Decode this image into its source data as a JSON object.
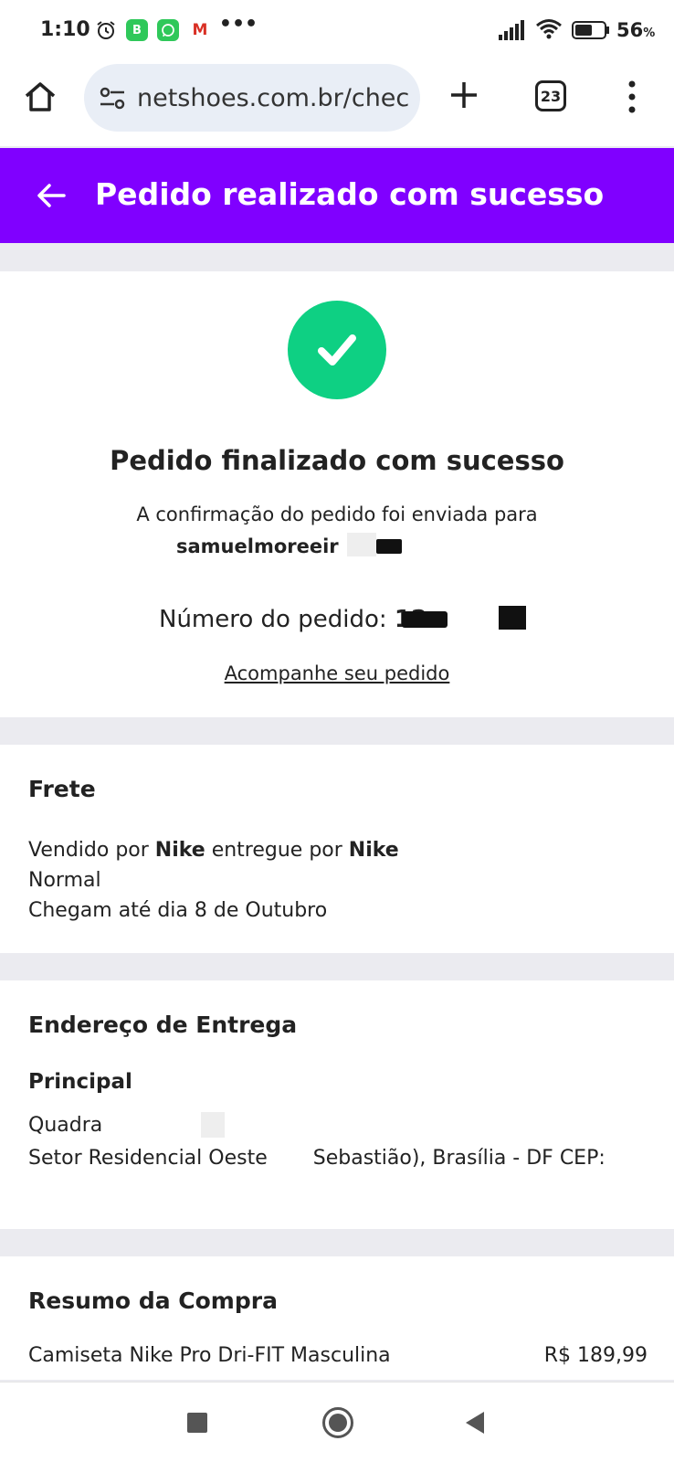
{
  "status_bar": {
    "time": "1:10",
    "battery_percent": "56",
    "battery_unit": "%",
    "icons": [
      "alarm-icon",
      "b-app-icon",
      "whatsapp-icon",
      "gmail-icon",
      "more-dots-icon",
      "signal-icon",
      "wifi-icon",
      "battery-icon"
    ],
    "b_app_letter": "B",
    "gmail_letter": "M",
    "dots": "•••"
  },
  "browser": {
    "url": "netshoes.com.br/chec",
    "tab_count": "23"
  },
  "header": {
    "title": "Pedido realizado com sucesso",
    "color": "#8000ff"
  },
  "success": {
    "title": "Pedido finalizado com sucesso",
    "confirmation_text": "A confirmação do pedido foi enviada para",
    "email": "samuelmoreeir",
    "order_label": "Número do pedido:",
    "order_number": "12",
    "track_link": "Acompanhe seu pedido",
    "check_color": "#0ed083"
  },
  "frete": {
    "title": "Frete",
    "sold_by_prefix": "Vendido por ",
    "seller": "Nike",
    "delivered_by_mid": " entregue por ",
    "carrier": "Nike",
    "shipping_type": "Normal",
    "arrival": "Chegam até dia 8 de Outubro"
  },
  "address": {
    "title": "Endereço de Entrega",
    "label": "Principal",
    "line1": "Quadra",
    "line2_start": "Setor Residencial Oeste",
    "line2_end": "Sebastião), Brasília - DF CEP:"
  },
  "summary": {
    "title": "Resumo da Compra",
    "items": [
      {
        "name": "Camiseta Nike Pro Dri-FIT Masculina",
        "price": "R$ 189,99"
      }
    ]
  }
}
